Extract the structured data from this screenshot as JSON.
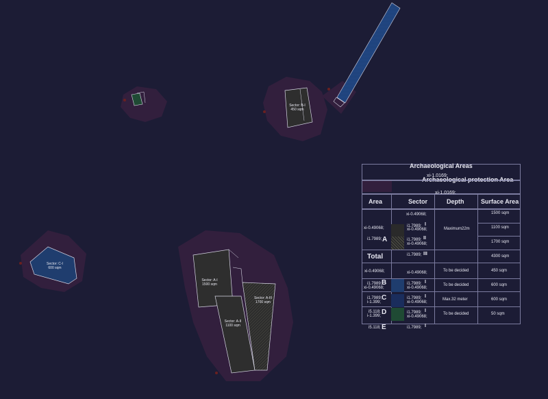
{
  "map": {
    "sectors": [
      {
        "label": "Sector: B-I",
        "area": "450 sqm"
      },
      {
        "label": "Sector: C-I",
        "area": "600 sqm"
      },
      {
        "label": "Sector: A-I",
        "area": "1500 sqm"
      },
      {
        "label": "Sector: A-III",
        "area": "1700 sqm"
      },
      {
        "label": "Sector: A-II",
        "area": "1100 sqm"
      }
    ]
  },
  "legend": {
    "title": "Archaeological  Areas",
    "subtitle": "Archaeological  protection Area",
    "overlap_code": "xi-1.0169;",
    "subtitle_code": "xi-1.0169;",
    "headers": [
      "Area",
      "Sector",
      "Depth",
      "Surface Area"
    ],
    "codes": {
      "xi": "xi-0.49068;",
      "i1": "i1.7989;",
      "i1short": "i1.7989;",
      "i5": "i5.118;",
      "i1neg": "i-1.399;"
    },
    "area_A": "A",
    "area_B": "B",
    "area_C": "C",
    "area_D": "D",
    "area_E": "E",
    "numerals": {
      "I": "I",
      "II": "II",
      "III": "III"
    },
    "total_label": "Total",
    "depth_A": "Maximum22m",
    "depth_B1": "To be decided",
    "depth_B2": "To be decided",
    "depth_C": "Max.32 meter",
    "depth_D": "To be decided",
    "surface": [
      "1500 sqm",
      "1100 sqm",
      "1700 sqm",
      "4300 sqm",
      "450 sqm",
      "600 sqm",
      "600 sqm",
      "50 sqm"
    ]
  },
  "colors": {
    "background": "#1c1c35",
    "zone": "#3a2040",
    "sector_fill": "#2e2e2e",
    "blue_fill": "#1f3d6e",
    "green_fill": "#1f4a34",
    "boundary": "#d8d8e6"
  }
}
